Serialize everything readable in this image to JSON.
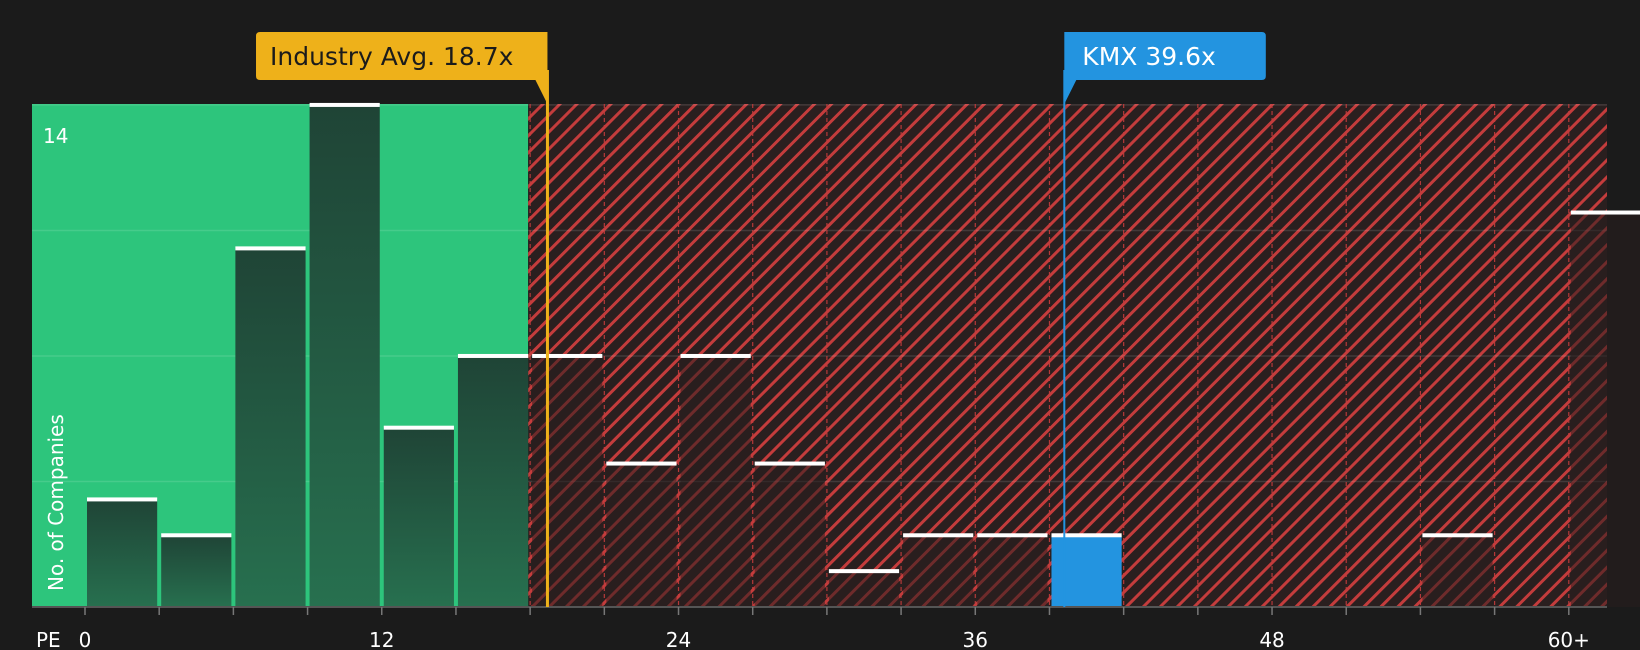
{
  "chart_data": {
    "type": "bar",
    "ylabel": "No. of Companies",
    "xlabel": "PE",
    "y_tick_label": "14",
    "ylim": [
      0,
      14.5
    ],
    "x_ticks": [
      "0",
      "12",
      "24",
      "36",
      "48",
      "60+"
    ],
    "bin_width": 3,
    "bins": [
      {
        "start": 0,
        "value": 3
      },
      {
        "start": 3,
        "value": 2
      },
      {
        "start": 6,
        "value": 10
      },
      {
        "start": 9,
        "value": 14
      },
      {
        "start": 12,
        "value": 5
      },
      {
        "start": 15,
        "value": 7
      },
      {
        "start": 18,
        "value": 7
      },
      {
        "start": 21,
        "value": 4
      },
      {
        "start": 24,
        "value": 7
      },
      {
        "start": 27,
        "value": 4
      },
      {
        "start": 30,
        "value": 1
      },
      {
        "start": 33,
        "value": 2
      },
      {
        "start": 36,
        "value": 2
      },
      {
        "start": 39,
        "value": 2,
        "highlight": true
      },
      {
        "start": 42,
        "value": 0
      },
      {
        "start": 45,
        "value": 0
      },
      {
        "start": 48,
        "value": 0
      },
      {
        "start": 51,
        "value": 0
      },
      {
        "start": 54,
        "value": 2
      },
      {
        "start": 57,
        "value": 0
      },
      {
        "start": 60,
        "value": 11
      }
    ],
    "fair_zone_end": 18,
    "industry_avg": {
      "label": "Industry Avg. 18.7x",
      "value": 18.7
    },
    "company": {
      "label": "KMX 39.6x",
      "value": 39.6
    },
    "colors": {
      "background": "#1b1b1b",
      "green_zone": "#2dc57c",
      "red_zone": "#c43c3c",
      "bar_dark": "#214a39",
      "highlight": "#2394e0",
      "industry": "#eeb11a",
      "company": "#2394e0"
    }
  }
}
